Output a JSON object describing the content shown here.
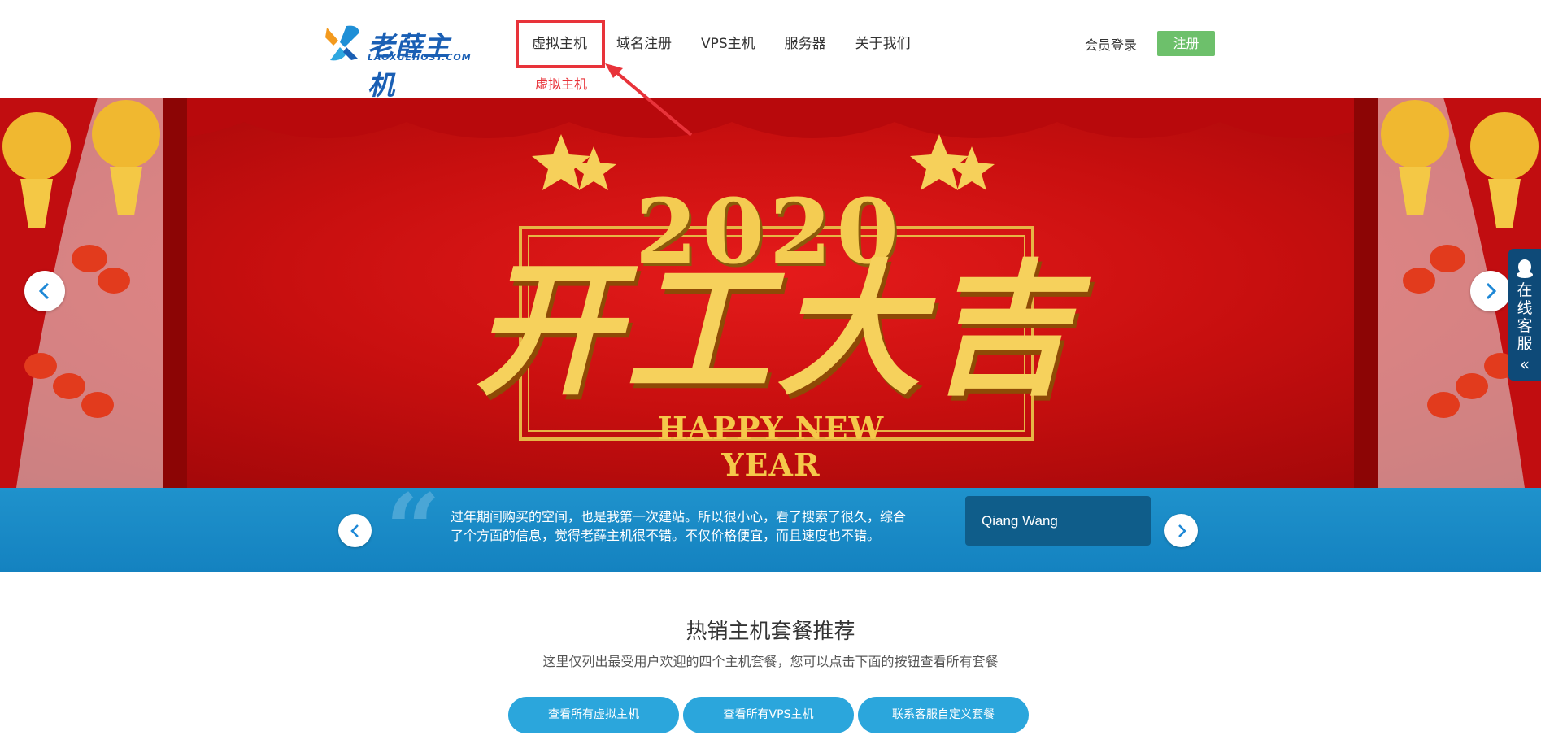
{
  "header": {
    "logo_text": "老薛主机",
    "logo_sub": "LAOXUEHOST.COM",
    "nav": [
      {
        "label": "虚拟主机"
      },
      {
        "label": "域名注册"
      },
      {
        "label": "VPS主机"
      },
      {
        "label": "服务器"
      },
      {
        "label": "关于我们"
      }
    ],
    "active_hint": "虚拟主机",
    "login_label": "会员登录",
    "register_label": "注册"
  },
  "banner": {
    "year": "2020",
    "title": "开工大吉",
    "subtitle": "HAPPY NEW YEAR",
    "prev_icon": "chevron-left-icon",
    "next_icon": "chevron-right-icon"
  },
  "side_service": {
    "label": "在线客服",
    "icon": "qq-icon",
    "collapse_icon": "double-chevron-left-icon"
  },
  "testimonial": {
    "quote_mark": "“",
    "text": "过年期间购买的空间，也是我第一次建站。所以很小心，看了搜索了很久，综合了个方面的信息，觉得老薛主机很不错。不仅价格便宜，而且速度也不错。",
    "author": "Qiang Wang"
  },
  "section": {
    "title": "热销主机套餐推荐",
    "subtitle": "这里仅列出最受用户欢迎的四个主机套餐，您可以点击下面的按钮查看所有套餐",
    "buttons": [
      {
        "label": "查看所有虚拟主机"
      },
      {
        "label": "查看所有VPS主机"
      },
      {
        "label": "联系客服自定义套餐"
      }
    ]
  },
  "colors": {
    "accent_red": "#e8333a",
    "register_green": "#6dc06b",
    "band_blue": "#1f92cc",
    "cta_blue": "#2ba6dc",
    "side_navy": "#0e4a78"
  }
}
